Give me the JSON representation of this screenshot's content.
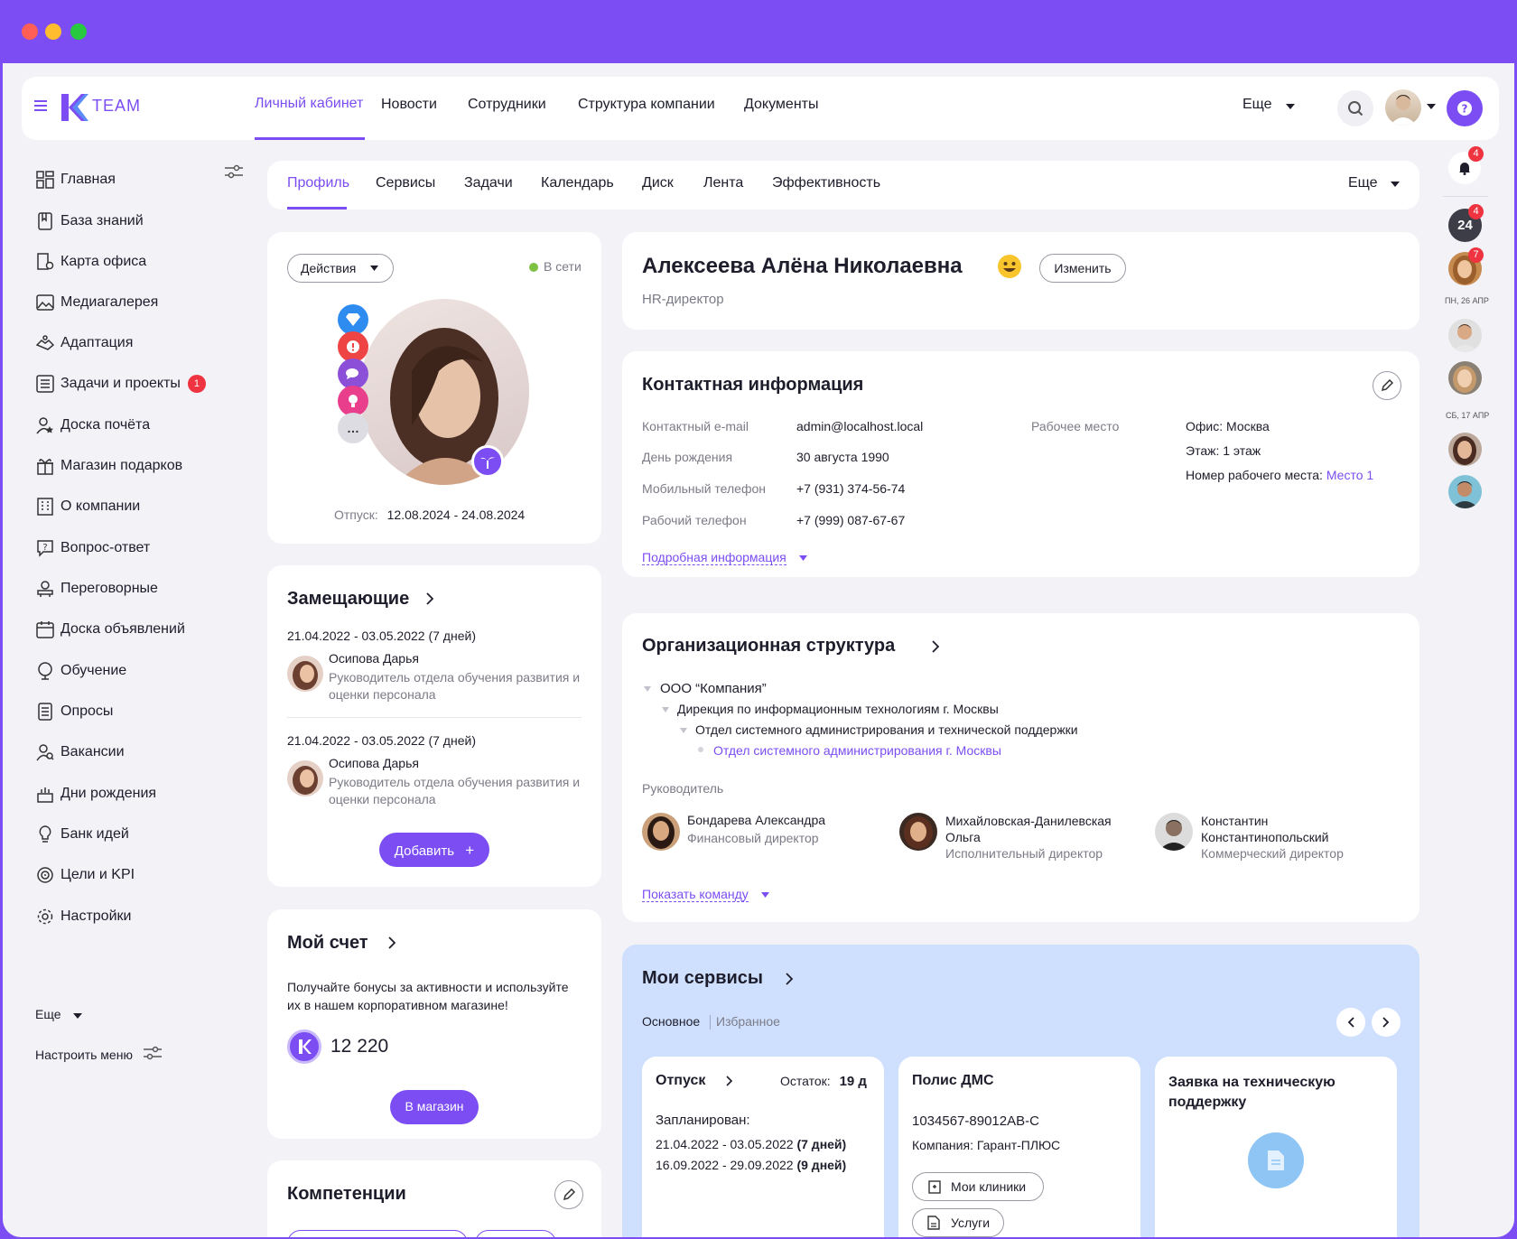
{
  "brand": {
    "logo_text": "TEAM",
    "accent": "#7b4df2"
  },
  "top_nav": {
    "items": [
      "Личный кабинет",
      "Новости",
      "Сотрудники",
      "Структура компании",
      "Документы"
    ],
    "more": "Еще"
  },
  "sidebar": {
    "items": [
      {
        "label": "Главная",
        "icon": "dashboard-icon"
      },
      {
        "label": "База знаний",
        "icon": "book-icon"
      },
      {
        "label": "Карта офиса",
        "icon": "office-map-icon"
      },
      {
        "label": "Медиагалерея",
        "icon": "image-icon"
      },
      {
        "label": "Адаптация",
        "icon": "handshake-icon"
      },
      {
        "label": "Задачи и проекты",
        "icon": "tasks-icon",
        "badge": "1"
      },
      {
        "label": "Доска почёта",
        "icon": "user-star-icon"
      },
      {
        "label": "Магазин подарков",
        "icon": "gift-icon"
      },
      {
        "label": "О компании",
        "icon": "building-icon"
      },
      {
        "label": "Вопрос-ответ",
        "icon": "question-icon"
      },
      {
        "label": "Переговорные",
        "icon": "meeting-icon"
      },
      {
        "label": "Доска объявлений",
        "icon": "calendar-board-icon"
      },
      {
        "label": "Обучение",
        "icon": "learning-icon"
      },
      {
        "label": "Опросы",
        "icon": "poll-icon"
      },
      {
        "label": "Вакансии",
        "icon": "vacancy-icon"
      },
      {
        "label": "Дни рождения",
        "icon": "cake-icon"
      },
      {
        "label": "Банк идей",
        "icon": "bulb-icon"
      },
      {
        "label": "Цели и KPI",
        "icon": "target-icon"
      },
      {
        "label": "Настройки",
        "icon": "gear-icon"
      }
    ],
    "more": "Еще",
    "customize": "Настроить меню"
  },
  "profile_tabs": {
    "items": [
      "Профиль",
      "Сервисы",
      "Задачи",
      "Календарь",
      "Диск",
      "Лента",
      "Эффективность"
    ],
    "more": "Еще"
  },
  "profile_card": {
    "actions": "Действия",
    "status": "В сети",
    "vacation_label": "Отпуск:",
    "vacation_dates": "12.08.2024 - 24.08.2024"
  },
  "header_card": {
    "name": "Алексеева Алёна Николаевна",
    "position": "HR-директор",
    "edit": "Изменить"
  },
  "contacts": {
    "title": "Контактная информация",
    "rows": [
      {
        "label": "Контактный e-mail",
        "value": "admin@localhost.local"
      },
      {
        "label": "День рождения",
        "value": "30 августа 1990"
      },
      {
        "label": "Мобильный телефон",
        "value": "+7 (931) 374-56-74"
      },
      {
        "label": "Рабочий телефон",
        "value": "+7 (999) 087-67-67"
      }
    ],
    "workplace_label": "Рабочее место",
    "office": "Офис: Москва",
    "floor": "Этаж: 1 этаж",
    "desk_label": "Номер рабочего места:",
    "desk_value": "Место 1",
    "more": "Подробная информация"
  },
  "org": {
    "title": "Организационная структура",
    "tree": [
      "ООО “Компания”",
      "Дирекция по информационным технологиям г. Москвы",
      "Отдел системного администрирования и технической поддержки",
      "Отдел системного администрирования г. Москвы"
    ],
    "managers_label": "Руководитель",
    "managers": [
      {
        "name": "Бондарева Александра",
        "role": "Финансовый директор"
      },
      {
        "name": "Михайловская-Данилевская Ольга",
        "role": "Исполнительный директор"
      },
      {
        "name": "Константин Константинопольский",
        "role": "Коммерческий директор"
      }
    ],
    "show_team": "Показать команду"
  },
  "deputies": {
    "title": "Замещающие",
    "items": [
      {
        "dates": "21.04.2022 - 03.05.2022 (7 дней)",
        "name": "Осипова Дарья",
        "role": "Руководитель отдела обучения развития и оценки персонала"
      },
      {
        "dates": "21.04.2022 - 03.05.2022 (7 дней)",
        "name": "Осипова Дарья",
        "role": "Руководитель отдела обучения развития и оценки персонала"
      }
    ],
    "add": "Добавить"
  },
  "account": {
    "title": "Мой счет",
    "text": "Получайте бонусы за активности и используйте их в нашем корпоративном магазине!",
    "balance": "12 220",
    "shop": "В магазин"
  },
  "competencies": {
    "title": "Компетенции"
  },
  "services": {
    "title": "Мои сервисы",
    "tab_main": "Основное",
    "tab_fav": "Избранное",
    "vacation": {
      "title": "Отпуск",
      "remain_label": "Остаток:",
      "remain_value": "19 д",
      "planned": "Запланирован:",
      "p1_dates": "21.04.2022 - 03.05.2022",
      "p1_days": "(7 дней)",
      "p2_dates": "16.09.2022 - 29.09.2022",
      "p2_days": "(9 дней)"
    },
    "dms": {
      "title": "Полис ДМС",
      "number": "1034567-89012AB-C",
      "company": "Компания: Гарант-ПЛЮС",
      "clinics": "Мои клиники",
      "services": "Услуги"
    },
    "support": {
      "title": "Заявка на техническую поддержку"
    }
  },
  "right_rail": {
    "notif_count": "4",
    "b24_count": "4",
    "avatar_count": "7",
    "date1": "ПН, 26 АПР",
    "date2": "СБ, 17 АПР"
  }
}
